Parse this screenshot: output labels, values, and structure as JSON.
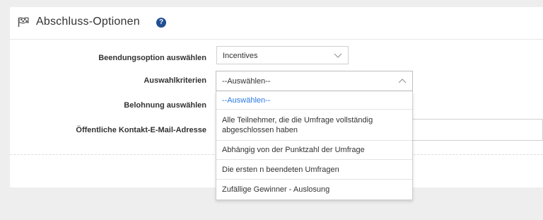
{
  "panel": {
    "title": "Abschluss-Optionen",
    "help_icon_glyph": "?"
  },
  "form": {
    "end_option": {
      "label": "Beendungsoption auswählen",
      "value": "Incentives"
    },
    "criteria": {
      "label": "Auswahlkriterien",
      "value": "--Auswählen--",
      "options": [
        "--Auswählen--",
        "Alle Teilnehmer, die die Umfrage vollständig abgeschlossen haben",
        "Abhängig von der Punktzahl der Umfrage",
        "Die ersten n beendeten Umfragen",
        "Zufällige Gewinner - Auslosung"
      ],
      "selected_index": 0
    },
    "reward": {
      "label": "Belohnung auswählen"
    },
    "contact_email": {
      "label": "Öffentliche Kontakt-E-Mail-Adresse",
      "value": ""
    }
  },
  "colors": {
    "accent": "#2a7ae2",
    "help_icon": "#1f4f93"
  }
}
